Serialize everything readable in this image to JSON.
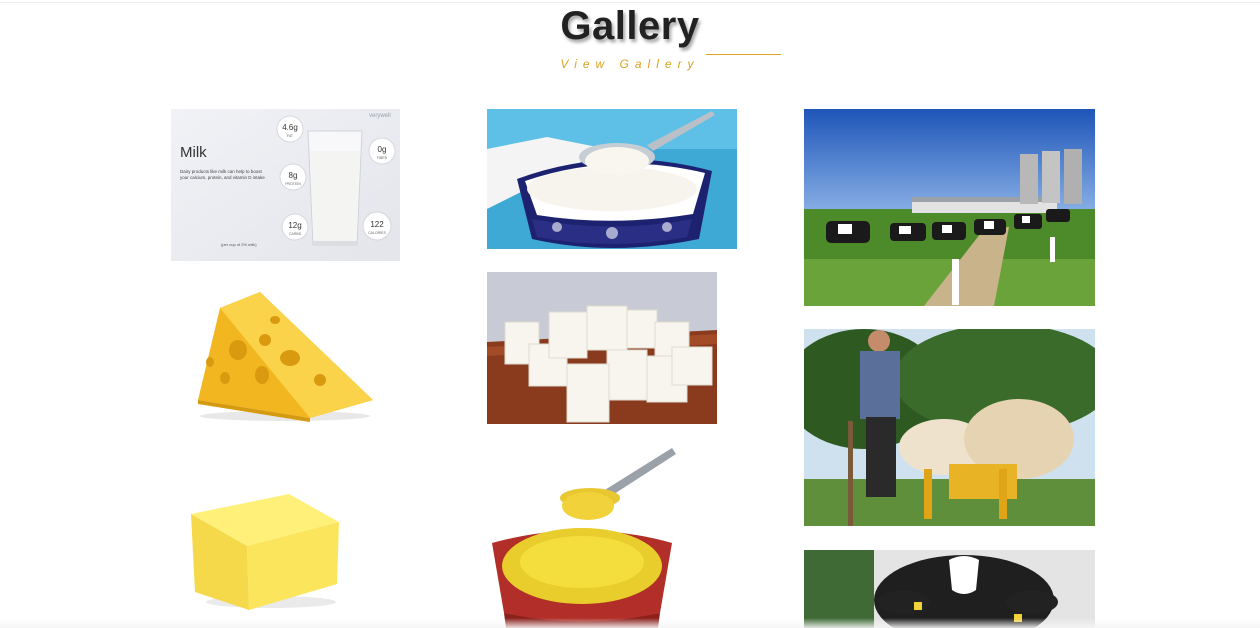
{
  "gallery": {
    "title": "Gallery",
    "subtitle": "View Gallery",
    "accent_color": "#d9a321"
  },
  "milk_card": {
    "brand": "verywell",
    "heading": "Milk",
    "description": "Dairy products like milk can help to boost your calcium, protein, and vitamin D intake",
    "serving": "(per cup of 2% milk)",
    "nutrients": [
      {
        "value": "4.6g",
        "label": "FAT"
      },
      {
        "value": "0g",
        "label": "FIBER"
      },
      {
        "value": "8g",
        "label": "PROTEIN"
      },
      {
        "value": "12g",
        "label": "CARBS"
      },
      {
        "value": "122",
        "label": "CALORIES"
      }
    ]
  },
  "images": [
    {
      "name": "milk-nutrition-image",
      "icon": "milk-glass"
    },
    {
      "name": "curd-bowl-image",
      "icon": "yogurt-bowl"
    },
    {
      "name": "cows-farm-image",
      "icon": "dairy-farm"
    },
    {
      "name": "cheese-image",
      "icon": "cheese-wedge"
    },
    {
      "name": "paneer-image",
      "icon": "paneer-cubes"
    },
    {
      "name": "farmer-cows-image",
      "icon": "farmer"
    },
    {
      "name": "butter-image",
      "icon": "butter-block"
    },
    {
      "name": "ghee-bowl-image",
      "icon": "ghee-bowl"
    },
    {
      "name": "cow-face-image",
      "icon": "cow-face"
    }
  ]
}
